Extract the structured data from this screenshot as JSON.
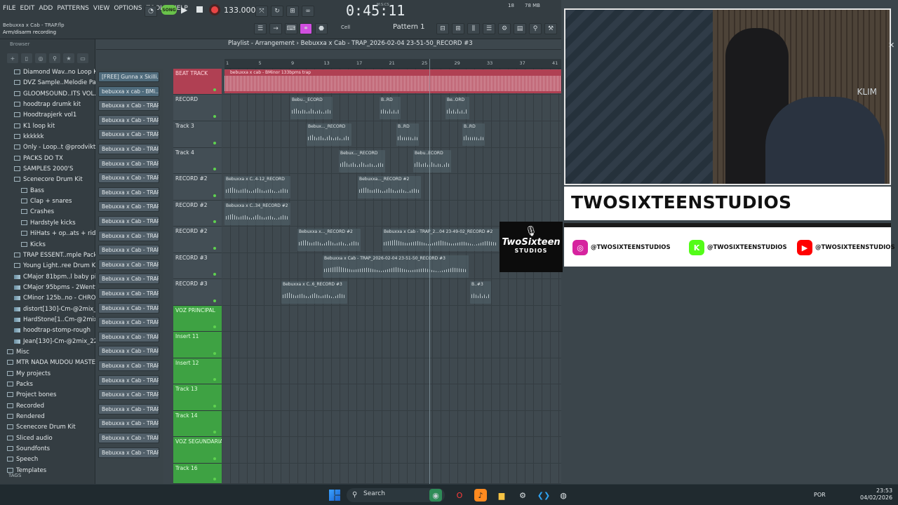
{
  "menu": [
    "FILE",
    "EDIT",
    "ADD",
    "PATTERNS",
    "VIEW",
    "OPTIONS",
    "TOOLS",
    "HELP"
  ],
  "transport": {
    "mode": "SONG",
    "tempo": "133.000",
    "time": "0:45:11",
    "time_units": "M:S:CS",
    "pattern": "Pattern 1",
    "snap": "Cell",
    "memory": "78 MB",
    "cpu": "18"
  },
  "file_info": "Bebuxxa x Cab - TRAP.flp",
  "hint": "Arm/disarm recording",
  "browser": {
    "title": "Browser",
    "tags_label": "TAGS",
    "items": [
      {
        "label": "Diamond Wav..no Loop Kit",
        "kind": "folder",
        "indent": 1
      },
      {
        "label": "DVZ Sample..Melodie Pack",
        "kind": "folder",
        "indent": 1
      },
      {
        "label": "GLOOMSOUND..ITS VOL.1",
        "kind": "folder",
        "indent": 1
      },
      {
        "label": "hoodtrap drumk kit",
        "kind": "folder",
        "indent": 1
      },
      {
        "label": "Hoodtrapjerk vol1",
        "kind": "folder",
        "indent": 1
      },
      {
        "label": "K1 loop kit",
        "kind": "folder",
        "indent": 1
      },
      {
        "label": "kkkkkk",
        "kind": "folder",
        "indent": 1
      },
      {
        "label": "Only - Loop..t @prodviktor",
        "kind": "folder",
        "indent": 1
      },
      {
        "label": "PACKS DO TX",
        "kind": "folder",
        "indent": 1
      },
      {
        "label": "SAMPLES 2000'S",
        "kind": "folder",
        "indent": 1
      },
      {
        "label": "Scenecore Drum Kit",
        "kind": "folder",
        "indent": 1
      },
      {
        "label": "Bass",
        "kind": "folder",
        "indent": 2
      },
      {
        "label": "Clap + snares",
        "kind": "folder",
        "indent": 2
      },
      {
        "label": "Crashes",
        "kind": "folder",
        "indent": 2
      },
      {
        "label": "Hardstyle kicks",
        "kind": "folder",
        "indent": 2
      },
      {
        "label": "HiHats + op..ats + rides",
        "kind": "folder",
        "indent": 2
      },
      {
        "label": "Kicks",
        "kind": "folder",
        "indent": 2
      },
      {
        "label": "TRAP ESSENT..mple Pack]",
        "kind": "folder",
        "indent": 1
      },
      {
        "label": "Young Light..ree Drum Kit)",
        "kind": "folder",
        "indent": 1
      },
      {
        "label": "CMajor 81bpm..l baby piano",
        "kind": "audio",
        "indent": 1
      },
      {
        "label": "CMajor 95bpms - 2Wenty",
        "kind": "audio",
        "indent": 1
      },
      {
        "label": "CMinor 125b..no - CHROME",
        "kind": "audio",
        "indent": 1
      },
      {
        "label": "distort[130]-Cm-@2mix_22",
        "kind": "audio",
        "indent": 1
      },
      {
        "label": "HardStone[1..Cm-@2mix_22",
        "kind": "audio",
        "indent": 1
      },
      {
        "label": "hoodtrap-stomp-rough",
        "kind": "audio",
        "indent": 1
      },
      {
        "label": "Jean[130]-Cm-@2mix_22",
        "kind": "audio",
        "indent": 1
      },
      {
        "label": "Misc",
        "kind": "folder",
        "indent": 0
      },
      {
        "label": "MTR NADA MUDOU MASTER",
        "kind": "folder",
        "indent": 0
      },
      {
        "label": "My projects",
        "kind": "folder",
        "indent": 0
      },
      {
        "label": "Packs",
        "kind": "folder",
        "indent": 0
      },
      {
        "label": "Project bones",
        "kind": "folder",
        "indent": 0
      },
      {
        "label": "Recorded",
        "kind": "folder",
        "indent": 0
      },
      {
        "label": "Rendered",
        "kind": "folder",
        "indent": 0
      },
      {
        "label": "Scenecore Drum Kit",
        "kind": "folder",
        "indent": 0
      },
      {
        "label": "Sliced audio",
        "kind": "folder",
        "indent": 0
      },
      {
        "label": "Soundfonts",
        "kind": "folder",
        "indent": 0
      },
      {
        "label": "Speech",
        "kind": "folder",
        "indent": 0
      },
      {
        "label": "Templates",
        "kind": "folder",
        "indent": 0
      }
    ]
  },
  "channels": [
    "[FREE] Gunna x Skilli..",
    "bebuxxa x cab - BMi..",
    "Bebuxxa x Cab - TRAP_2..",
    "Bebuxxa x Cab - TRAP_2..",
    "Bebuxxa x Cab - TRAP_2..",
    "Bebuxxa x Cab - TRAP_2..",
    "Bebuxxa x Cab - TRAP_2..",
    "Bebuxxa x Cab - TRAP_2..",
    "Bebuxxa x Cab - TRAP_2..",
    "Bebuxxa x Cab - TRAP_2..",
    "Bebuxxa x Cab - TRAP_2..",
    "Bebuxxa x Cab - TRAP_2..",
    "Bebuxxa x Cab - TRAP_2..",
    "Bebuxxa x Cab - TRAP_2..",
    "Bebuxxa x Cab - TRAP_2..",
    "Bebuxxa x Cab - TRAP_2..",
    "Bebuxxa x Cab - TRAP_2..",
    "Bebuxxa x Cab - TRAP_2..",
    "Bebuxxa x Cab - TRAP_2..",
    "Bebuxxa x Cab - TRAP_2..",
    "Bebuxxa x Cab - TRAP_2..",
    "Bebuxxa x Cab - TRAP_2..",
    "Bebuxxa x Cab - TRAP_2..",
    "Bebuxxa x Cab - TRAP_2..",
    "Bebuxxa x Cab - TRAP_2..",
    "Bebuxxa x Cab - TRAP_2..",
    "Bebuxxa x Cab - TRAP_2.."
  ],
  "playlist": {
    "title": "Playlist - Arrangement",
    "path": "Bebuxxa x Cab - TRAP_2026-02-04 23-51-50_RECORD #3",
    "ruler": [
      "1",
      "5",
      "9",
      "13",
      "17",
      "21",
      "25",
      "29",
      "33",
      "37",
      "41"
    ],
    "beat_clip": "bebuxxa x cab - BMinor 133bpms trap",
    "tracks": [
      {
        "name": "BEAT TRACK",
        "color": "red"
      },
      {
        "name": "RECORD",
        "color": "gray"
      },
      {
        "name": "Track 3",
        "color": "gray"
      },
      {
        "name": "Track 4",
        "color": "gray"
      },
      {
        "name": "RECORD #2",
        "color": "gray"
      },
      {
        "name": "RECORD #2",
        "color": "gray"
      },
      {
        "name": "RECORD #2",
        "color": "gray"
      },
      {
        "name": "RECORD #3",
        "color": "gray"
      },
      {
        "name": "RECORD #3",
        "color": "gray"
      },
      {
        "name": "VOZ PRINCIPAL",
        "color": "green"
      },
      {
        "name": "Insert 11",
        "color": "green"
      },
      {
        "name": "Insert 12",
        "color": "green"
      },
      {
        "name": "Track 13",
        "color": "green"
      },
      {
        "name": "Track 14",
        "color": "green"
      },
      {
        "name": "VOZ SEGUNDARIA",
        "color": "green"
      },
      {
        "name": "Track 16",
        "color": "green"
      }
    ],
    "clips": [
      {
        "lane": 1,
        "label": "Bebu.._ECORD"
      },
      {
        "lane": 1,
        "label": "B..RD"
      },
      {
        "lane": 1,
        "label": "Be..ORD"
      },
      {
        "lane": 2,
        "label": "Bebux..._RECORD"
      },
      {
        "lane": 2,
        "label": "B..RD"
      },
      {
        "lane": 2,
        "label": "B..RD"
      },
      {
        "lane": 3,
        "label": "Bebux..._RECORD"
      },
      {
        "lane": 3,
        "label": "Bebu..ECORD"
      },
      {
        "lane": 4,
        "label": "Bebuxxa x C..4-12_RECORD"
      },
      {
        "lane": 4,
        "label": "Bebuxxa..._RECORD #2"
      },
      {
        "lane": 5,
        "label": "Bebuxxa x C..34_RECORD #2"
      },
      {
        "lane": 6,
        "label": "Bebuxxa x..._RECORD #2"
      },
      {
        "lane": 6,
        "label": "Bebuxxa x Cab - TRAP_2...04 23-49-02_RECORD #2"
      },
      {
        "lane": 7,
        "label": "Bebuxxa x Cab - TRAP_2026-02-04 23-51-50_RECORD #3"
      },
      {
        "lane": 8,
        "label": "Bebuxxa x C..6_RECORD #3"
      },
      {
        "lane": 8,
        "label": "B..#3"
      }
    ]
  },
  "overlay": {
    "brand": "TWOSIXTEENSTUDIOS",
    "logo_top": "TwoSixteen",
    "logo_bottom": "STUDIOS",
    "wall_logo": "KLIM",
    "socials": [
      {
        "icon": "instagram-icon",
        "handle": "@TWOSIXTEENSTUDIOS",
        "color": "#d6249f"
      },
      {
        "icon": "kick-icon",
        "handle": "@TWOSIXTEENSTUDIOS",
        "color": "#53fc18"
      },
      {
        "icon": "youtube-icon",
        "handle": "@TWOSIXTEENSTUDIOS",
        "color": "#ff0000"
      }
    ]
  },
  "taskbar": {
    "search": "Search",
    "lang": "POR",
    "time": "23:53",
    "date": "04/02/2026"
  }
}
